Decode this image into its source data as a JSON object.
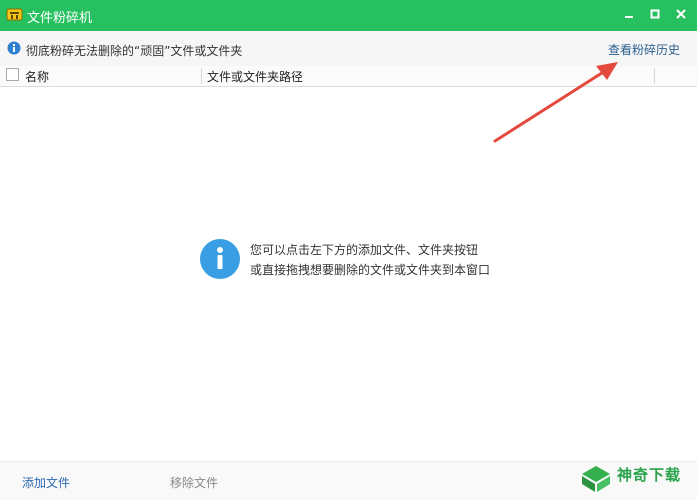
{
  "window": {
    "title": "文件粉碎机",
    "accent_color": "#27c060"
  },
  "infobar": {
    "message": "彻底粉碎无法删除的“顽固”文件或文件夹",
    "history_link": "查看粉碎历史"
  },
  "table": {
    "columns": [
      "名称",
      "文件或文件夹路径"
    ]
  },
  "empty_hint": {
    "line1": "您可以点击左下方的添加文件、文件夹按钮",
    "line2": "或直接拖拽想要删除的文件或文件夹到本窗口"
  },
  "footer": {
    "add_file": "添加文件",
    "remove_file": "移除文件"
  },
  "watermark": {
    "text": "神奇下载"
  }
}
